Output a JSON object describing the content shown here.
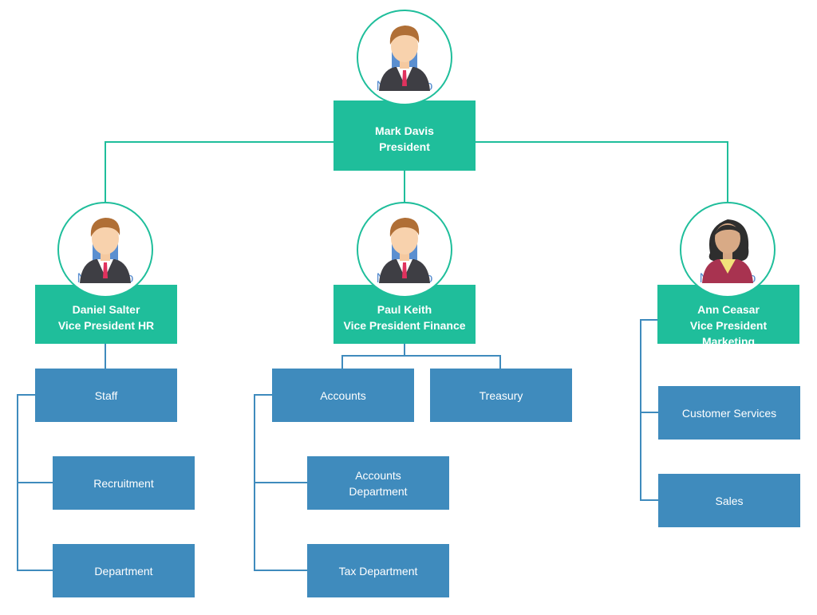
{
  "colors": {
    "manager": "#1fbe9b",
    "department": "#3f8bbd",
    "connector_top": "#1fbe9b",
    "connector_bottom": "#3f8bbd"
  },
  "placeholder_text": "No Photo",
  "president": {
    "name": "Mark Davis",
    "title": "President",
    "avatar": "male-avatar-icon"
  },
  "vps": [
    {
      "name": "Daniel Salter",
      "title": "Vice President HR",
      "avatar": "male-avatar-icon",
      "departments": [
        "Staff",
        "Recruitment",
        "Department"
      ]
    },
    {
      "name": "Paul Keith",
      "title": "Vice President Finance",
      "avatar": "male-avatar-icon",
      "departments": [
        "Accounts",
        "Treasury",
        "Accounts Department",
        "Tax Department"
      ]
    },
    {
      "name": "Ann Ceasar",
      "title": "Vice President Marketing",
      "avatar": "female-avatar-icon",
      "departments": [
        "Customer Services",
        "Sales"
      ]
    }
  ]
}
